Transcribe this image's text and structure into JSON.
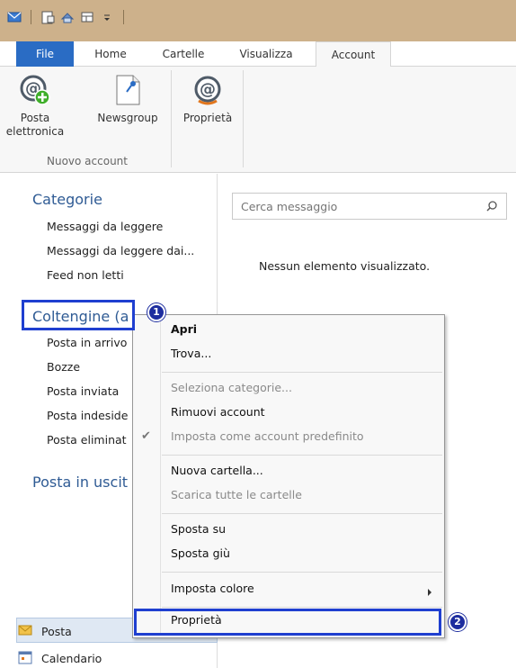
{
  "ribbon_tabs": [
    "File",
    "Home",
    "Cartelle",
    "Visualizza",
    "Account"
  ],
  "ribbon": {
    "email_button": "Posta\nelettronica",
    "email_line1": "Posta",
    "email_line2": "elettronica",
    "newsgroup_button": "Newsgroup",
    "properties_button": "Proprietà",
    "group_label": "Nuovo account"
  },
  "sidebar": {
    "categories_title": "Categorie",
    "categories": [
      "Messaggi da leggere",
      "Messaggi da leggere dai...",
      "Feed non letti"
    ],
    "account_title": "Coltengine (a",
    "folders": [
      "Posta in arrivo",
      "Bozze",
      "Posta inviata",
      "Posta indeside",
      "Posta eliminat"
    ],
    "outbox_title": "Posta in uscit"
  },
  "search": {
    "placeholder": "Cerca messaggio"
  },
  "main": {
    "empty_text": "Nessun elemento visualizzato."
  },
  "nav": {
    "mail": "Posta",
    "calendar": "Calendario"
  },
  "context_menu": {
    "open": "Apri",
    "find": "Trova...",
    "select_categories": "Seleziona categorie...",
    "remove_account": "Rimuovi account",
    "set_default": "Imposta come account predefinito",
    "new_folder": "Nuova cartella...",
    "download_folders": "Scarica tutte le cartelle",
    "move_up": "Sposta su",
    "move_down": "Sposta giù",
    "set_color": "Imposta colore",
    "properties": "Proprietà"
  },
  "badges": {
    "step1": "1",
    "step2": "2"
  },
  "colors": {
    "file_tab": "#2a6cc4",
    "titlebar": "#cdb18b",
    "highlight": "#1f3fd0",
    "section_title": "#2f5b94"
  }
}
